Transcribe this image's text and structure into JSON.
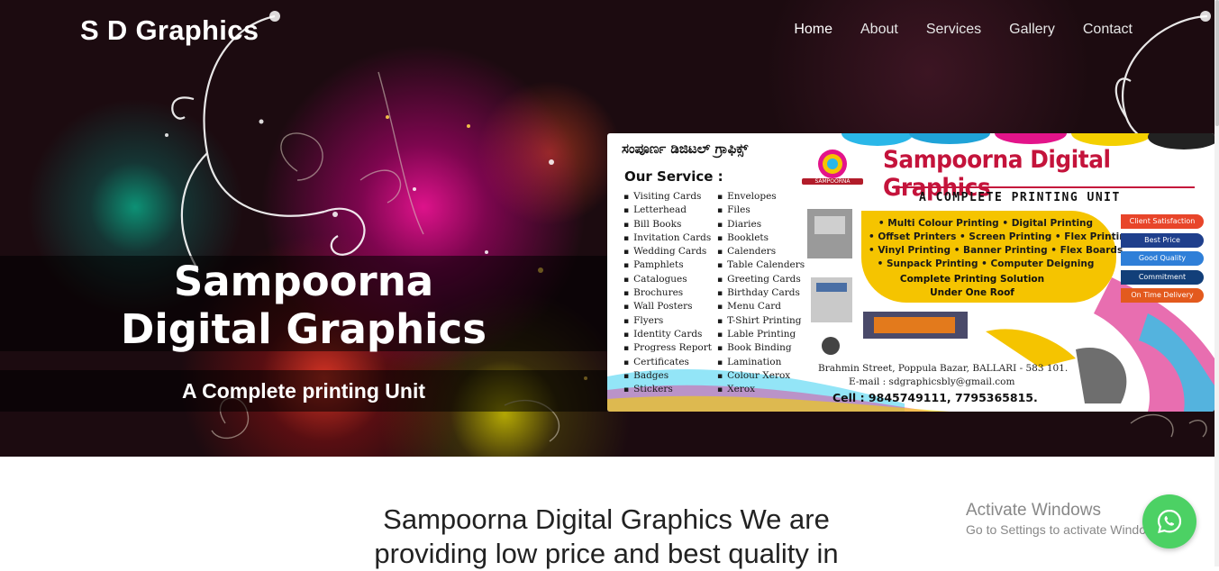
{
  "nav": {
    "brand": "S D Graphics",
    "links": [
      {
        "label": "Home",
        "active": true
      },
      {
        "label": "About"
      },
      {
        "label": "Services"
      },
      {
        "label": "Gallery"
      },
      {
        "label": "Contact"
      }
    ]
  },
  "hero": {
    "title_line1": "Sampoorna",
    "title_line2": "Digital Graphics",
    "subtitle": "A Complete printing Unit"
  },
  "banner": {
    "kannada_title": "ಸಂಪೂರ್ಣ ಡಿಜಿಟಲ್ ಗ್ರಾಫಿಕ್ಸ್",
    "logo_text": "SAMPOORNA",
    "company": "Sampoorna Digital Graphics",
    "tagline": "A COMPLETE PRINTING UNIT",
    "service_heading": "Our Service :",
    "services_col1": [
      "Visiting Cards",
      "Letterhead",
      "Bill Books",
      "Invitation Cards",
      "Wedding Cards",
      "Pamphlets",
      "Catalogues",
      "Brochures",
      "Wall Posters",
      "Flyers",
      "Identity Cards",
      "Progress Report",
      "Certificates",
      "Badges",
      "Stickers"
    ],
    "services_col2": [
      "Envelopes",
      "Files",
      "Diaries",
      "Booklets",
      "Calenders",
      "Table Calenders",
      "Greeting Cards",
      "Birthday Cards",
      "Menu Card",
      "T-Shirt Printing",
      "Lable Printing",
      "Book Binding",
      "Lamination",
      "Colour Xerox",
      "Xerox"
    ],
    "printing_lines": [
      "• Multi Colour Printing • Digital Printing",
      "• Offset Printers • Screen Printing • Flex Printing",
      "• Vinyl Printing • Banner Printing • Flex Boards",
      "• Sunpack Printing • Computer Deigning"
    ],
    "solution_line1": "Complete Printing Solution",
    "solution_line2": "Under One Roof",
    "pills": [
      "Client Satisfaction",
      "Best Price",
      "Good Quality",
      "Commitment",
      "On Time Delivery"
    ],
    "address": "Brahmin Street, Poppula Bazar, BALLARI - 583 101.",
    "email": "E-mail : sdgraphicsbly@gmail.com",
    "cell": "Cell : 9845749111, 7795365815."
  },
  "content": {
    "heading_line1": "Sampoorna Digital Graphics We are",
    "heading_line2": "providing low price and best quality in"
  },
  "overlay": {
    "activate_title": "Activate Windows",
    "activate_sub": "Go to Settings to activate Windows."
  },
  "colors": {
    "brand_red": "#c4133b",
    "whatsapp_green": "#4cd164",
    "hero_bg": "#1c0b10"
  },
  "icons": {
    "whatsapp": "whatsapp-icon"
  }
}
